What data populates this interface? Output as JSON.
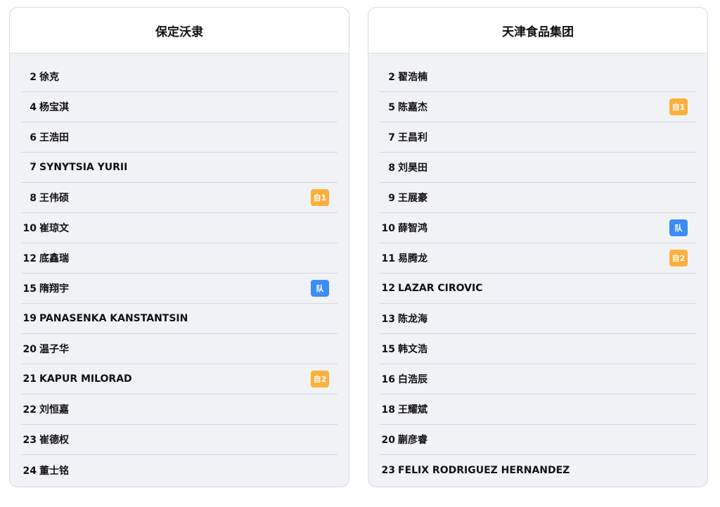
{
  "colors": {
    "self_badge": "#fbb03b",
    "team_badge": "#3b8cf5",
    "card_bg": "#f1f2f6",
    "header_bg": "#ffffff"
  },
  "teams": [
    {
      "name": "保定沃隶",
      "players": [
        {
          "number": "2",
          "name": "徐克",
          "badge": ""
        },
        {
          "number": "4",
          "name": "杨宝淇",
          "badge": ""
        },
        {
          "number": "6",
          "name": "王浩田",
          "badge": ""
        },
        {
          "number": "7",
          "name": "SYNYTSIA YURII",
          "badge": ""
        },
        {
          "number": "8",
          "name": "王伟硕",
          "badge": "自1",
          "badge_type": "self"
        },
        {
          "number": "10",
          "name": "崔琼文",
          "badge": ""
        },
        {
          "number": "12",
          "name": "底鑫瑞",
          "badge": ""
        },
        {
          "number": "15",
          "name": "隋翔宇",
          "badge": "队",
          "badge_type": "team"
        },
        {
          "number": "19",
          "name": "PANASENKA KANSTANTSIN",
          "badge": ""
        },
        {
          "number": "20",
          "name": "温子华",
          "badge": ""
        },
        {
          "number": "21",
          "name": "KAPUR MILORAD",
          "badge": "自2",
          "badge_type": "self"
        },
        {
          "number": "22",
          "name": "刘恒嘉",
          "badge": ""
        },
        {
          "number": "23",
          "name": "崔德权",
          "badge": ""
        },
        {
          "number": "24",
          "name": "董士铭",
          "badge": ""
        }
      ]
    },
    {
      "name": "天津食品集团",
      "players": [
        {
          "number": "2",
          "name": "翟浩楠",
          "badge": ""
        },
        {
          "number": "5",
          "name": "陈嘉杰",
          "badge": "自1",
          "badge_type": "self"
        },
        {
          "number": "7",
          "name": "王昌利",
          "badge": ""
        },
        {
          "number": "8",
          "name": "刘昊田",
          "badge": ""
        },
        {
          "number": "9",
          "name": "王展豪",
          "badge": ""
        },
        {
          "number": "10",
          "name": "薛智鸿",
          "badge": "队",
          "badge_type": "team"
        },
        {
          "number": "11",
          "name": "易腾龙",
          "badge": "自2",
          "badge_type": "self"
        },
        {
          "number": "12",
          "name": "LAZAR CIROVIC",
          "badge": ""
        },
        {
          "number": "13",
          "name": "陈龙海",
          "badge": ""
        },
        {
          "number": "15",
          "name": "韩文浩",
          "badge": ""
        },
        {
          "number": "16",
          "name": "白浩辰",
          "badge": ""
        },
        {
          "number": "18",
          "name": "王耀斌",
          "badge": ""
        },
        {
          "number": "20",
          "name": "蒯彦睿",
          "badge": ""
        },
        {
          "number": "23",
          "name": "FELIX RODRIGUEZ HERNANDEZ",
          "badge": ""
        }
      ]
    }
  ]
}
